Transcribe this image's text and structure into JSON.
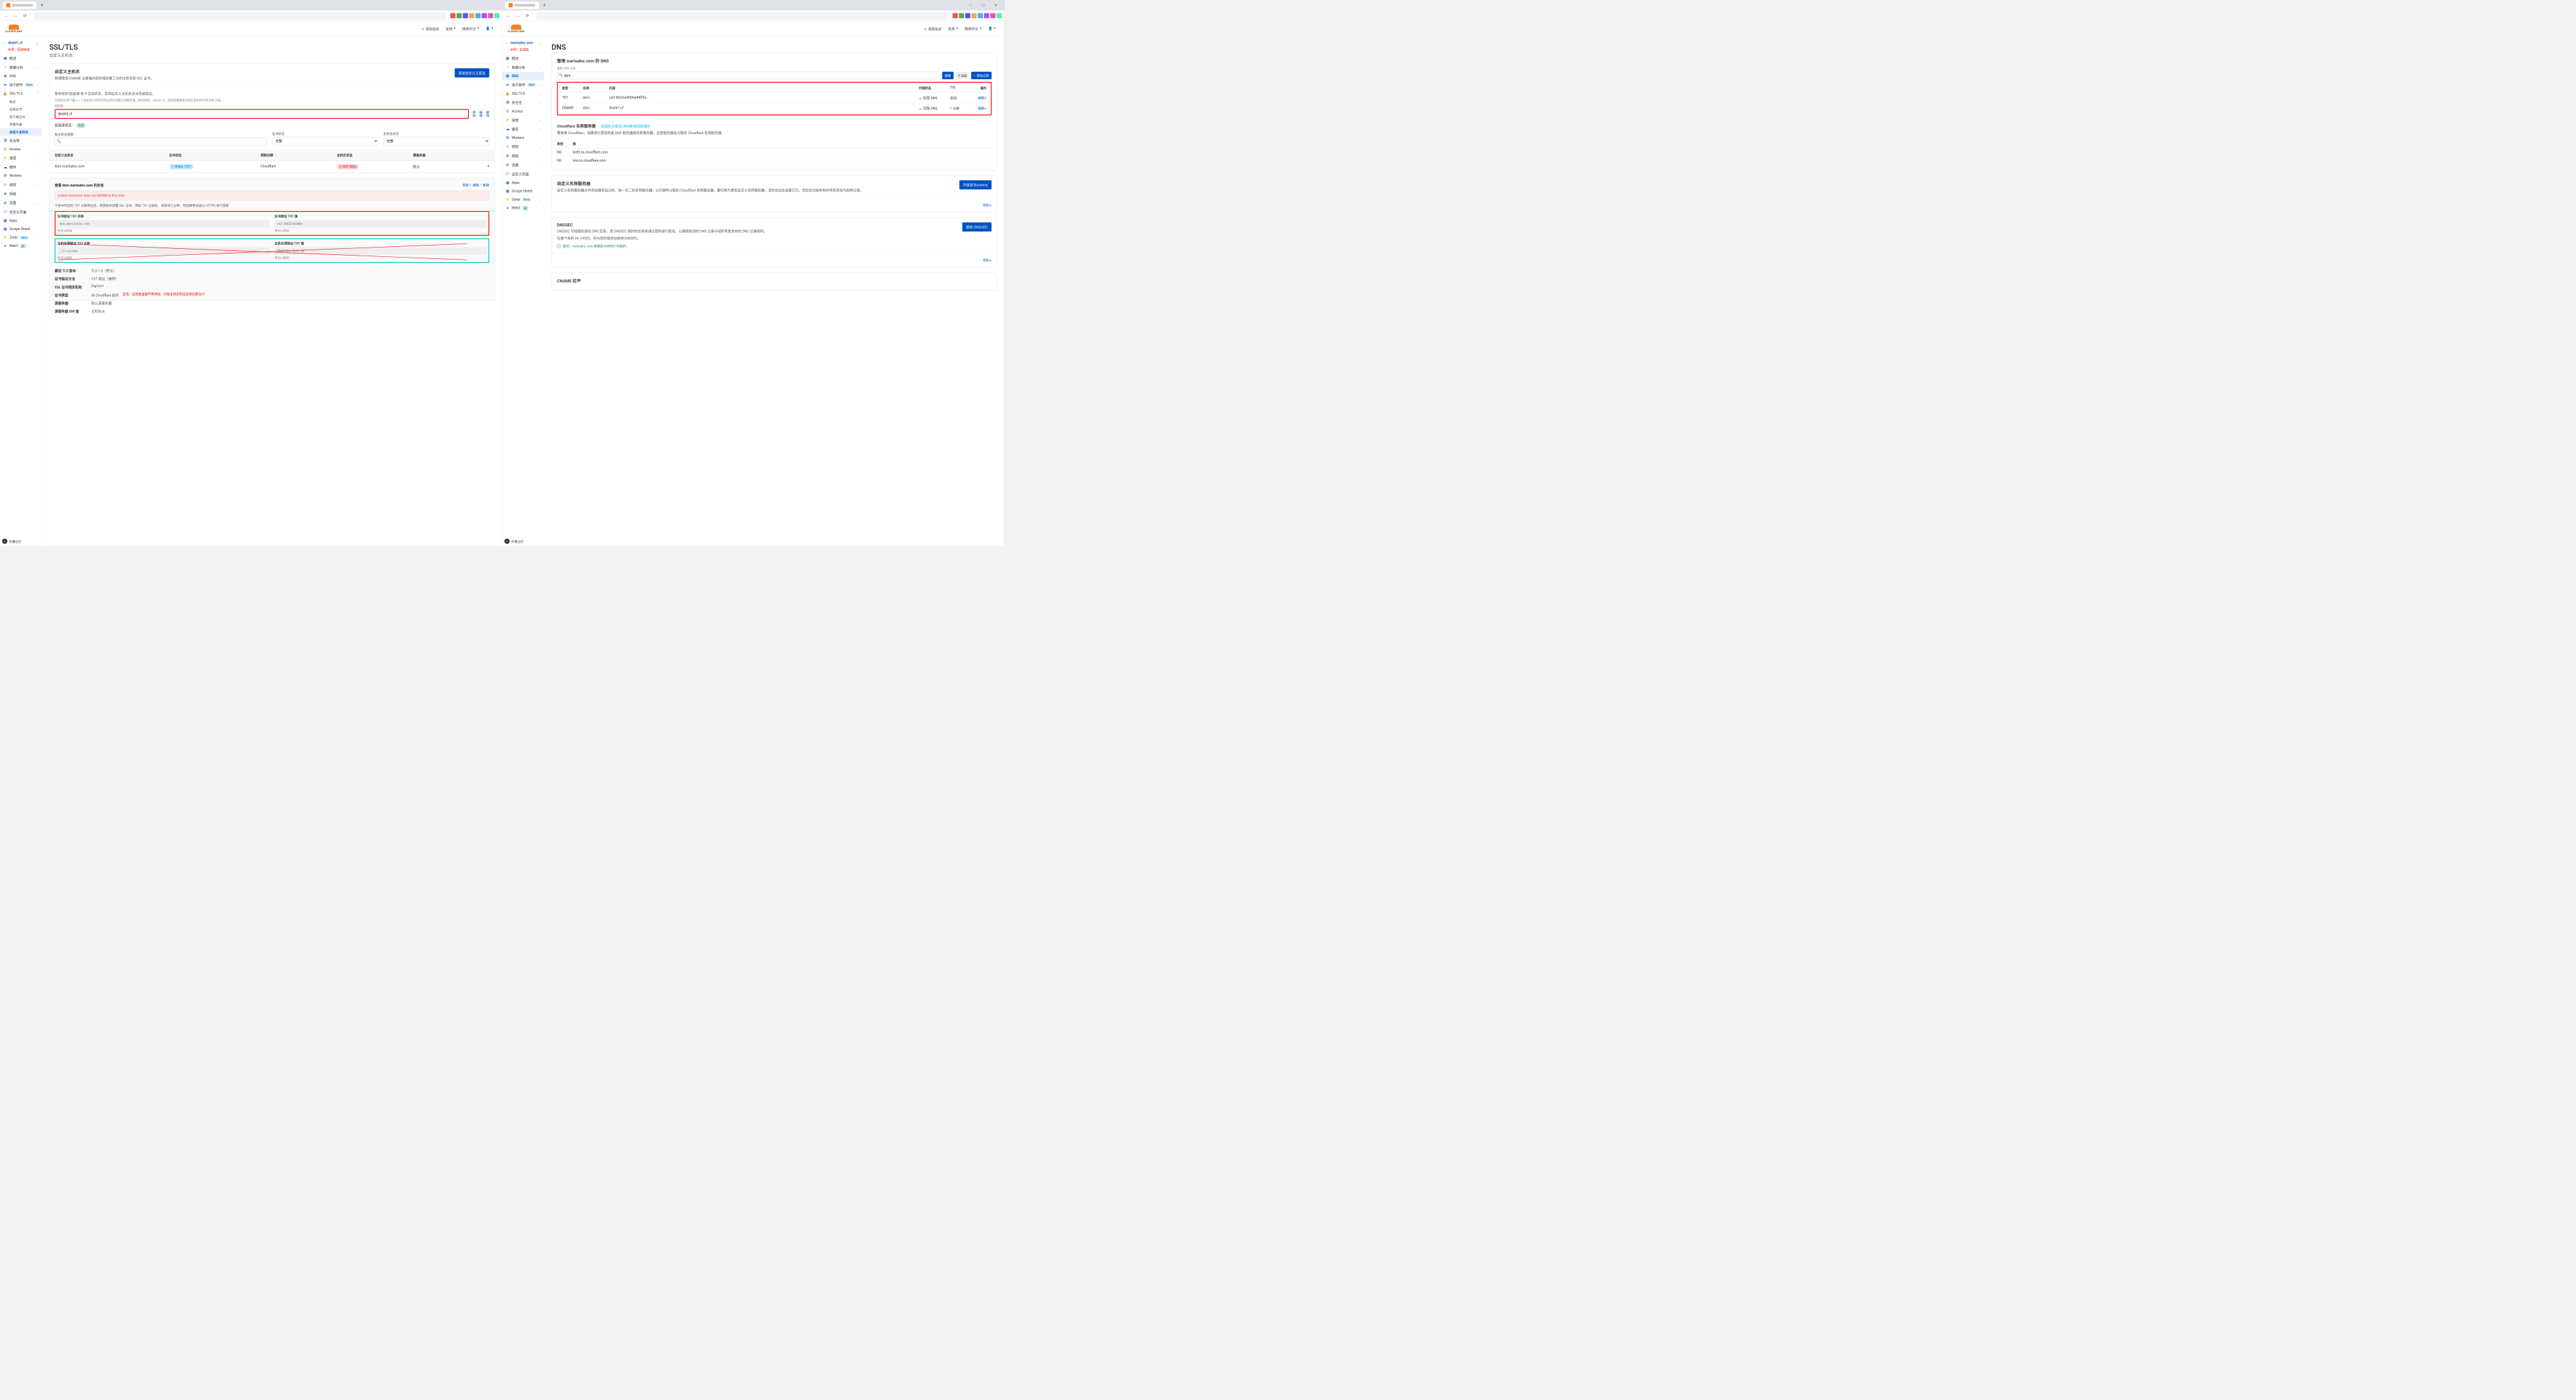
{
  "browser": {
    "newtab": "+",
    "win": {
      "min": "—",
      "max": "☐",
      "close": "✕"
    }
  },
  "header": {
    "add_site": "添加站点",
    "support": "支持",
    "lang": "简体中文",
    "logo": "CLOUDFLARE"
  },
  "left": {
    "crumb": "dnsht1.cf",
    "anno": "示例：回源域名",
    "nav": [
      {
        "ico": "▦",
        "label": "概述"
      },
      {
        "ico": "◔",
        "label": "数据分析",
        "car": "⌄"
      },
      {
        "ico": "⧉",
        "label": "DNS"
      },
      {
        "ico": "✉",
        "label": "电子邮件",
        "badge": "Beta",
        "car": "⌄"
      },
      {
        "ico": "🔒",
        "label": "SSL/TLS",
        "car": "^",
        "children": [
          "概述",
          "边缘证书",
          "客户端证书",
          "源服务器",
          "自定义主机名"
        ]
      },
      {
        "ico": "🛡",
        "label": "安全性",
        "car": "⌄"
      },
      {
        "ico": "⊙",
        "label": "Access"
      },
      {
        "ico": "⚡",
        "label": "速度",
        "car": "⌄"
      },
      {
        "ico": "☁",
        "label": "缓存",
        "car": "⌄"
      },
      {
        "ico": "⚙",
        "label": "Workers"
      },
      {
        "ico": "⟐",
        "label": "规则",
        "car": "⌄"
      },
      {
        "ico": "⊕",
        "label": "网络"
      },
      {
        "ico": "⇄",
        "label": "流量",
        "car": "⌄"
      },
      {
        "ico": "🏳",
        "label": "自定义页面"
      },
      {
        "ico": "▦",
        "label": "Apps"
      },
      {
        "ico": "▦",
        "label": "Scrape Shield"
      },
      {
        "ico": "⚡",
        "label": "Zaraz",
        "badge": "Beta",
        "car": "⌄"
      },
      {
        "ico": "✦",
        "label": "Web3",
        "badge": "新"
      }
    ],
    "page": {
      "h1": "SSL/TLS",
      "sub": "自定义主机名",
      "card1_title": "自定义主机名",
      "card1_desc": "管理使用 CNAME 记录指向您的域的第三方的主机名和 SSL 证书。",
      "add_btn": "添加自定义主机名",
      "note1": "除非您的\"回退源\"处于活动状态，否则自定义主机名无法完成验证。",
      "note2": "在您的区域下输入一个主机名以用作您的主机名的默认源服务器。例如回退，dnsht1.cf。回退源需要是您的区域中的代理 DNS 记录。",
      "fallback_label": "回退源",
      "fallback_value": "dnsht1.cf",
      "refresh": "刷新",
      "edit": "编辑",
      "delete": "删除",
      "status_label": "回退源状态：",
      "status_val": "有效",
      "search_label": "按主机名搜索",
      "cert_status_label": "证书状态",
      "host_status_label": "主机名状态",
      "all": "全部",
      "cols": {
        "hn": "自定义主机名",
        "cs": "证书状态",
        "dd": "到期日期",
        "hs": "主机名状态",
        "os": "源服务器"
      },
      "row": {
        "hn": "dsm.marisalnc.com",
        "cs": "待验证 (TXT)",
        "dd": "Cloudflare",
        "hs": "待定 (错误)",
        "os": "默认"
      },
      "detail_title_pre": "查看 ",
      "detail_title_dom": "dsm.marisalnc.com",
      "detail_title_post": " 的状态",
      "err": "custom hostname does not CNAME to this zone.",
      "detail_note": "下表中列出的 TXT 记录到位后，将颁发并部署 SSL 证书。添加 TXT 记录后，请等待几分钟，然后再尝试通过 HTTPS 进行连接",
      "cert_txt_name_label": "证书验证 TXT 名称",
      "cert_txt_value_label": "证书验证 TXT 值",
      "cert_txt_name": "dsm.marisalnc.com",
      "cert_txt_value": "ca3-3b63ce4306e",
      "host_txt_name_label": "主机名预验证 TXT 名称",
      "host_txt_value_label": "主机名预验证 TXT 值",
      "host_txt_name": "_cf-custom-",
      "host_txt_value": "20d4f16e-1bf1-49",
      "copy": "单击以复制",
      "blue_anno": "蓝色：蓝色框里面不用添加，仅限主域名和自选域名都在CF",
      "props": [
        {
          "k": "最低 TLS 版本",
          "v": "TLS 1.0（默认）"
        },
        {
          "k": "证书验证方法",
          "v": "TXT 验证（推荐）"
        },
        {
          "k": "SSL 证书颁发机构",
          "v": "DigiCert"
        },
        {
          "k": "证书类型",
          "v": "由 Cloudflare 提供"
        },
        {
          "k": "源服务器",
          "v": "默认源服务器"
        },
        {
          "k": "源服务器 SNI 值",
          "v": "主机标头"
        }
      ]
    }
  },
  "right": {
    "crumb": "marisalnc.com",
    "anno": "示例：主域名",
    "nav": [
      {
        "ico": "▦",
        "label": "概述"
      },
      {
        "ico": "◔",
        "label": "数据分析",
        "car": "⌄"
      },
      {
        "ico": "⧉",
        "label": "DNS"
      },
      {
        "ico": "✉",
        "label": "电子邮件",
        "badge": "Beta",
        "car": "⌄"
      },
      {
        "ico": "🔒",
        "label": "SSL/TLS",
        "car": "⌄"
      },
      {
        "ico": "🛡",
        "label": "安全性",
        "car": "⌄"
      },
      {
        "ico": "⊙",
        "label": "Access"
      },
      {
        "ico": "⚡",
        "label": "速度",
        "car": "⌄"
      },
      {
        "ico": "☁",
        "label": "缓存",
        "car": "⌄"
      },
      {
        "ico": "⚙",
        "label": "Workers"
      },
      {
        "ico": "⟐",
        "label": "规则",
        "car": "⌄"
      },
      {
        "ico": "⊕",
        "label": "网络"
      },
      {
        "ico": "⇄",
        "label": "流量",
        "car": "⌄"
      },
      {
        "ico": "🏳",
        "label": "自定义页面"
      },
      {
        "ico": "▦",
        "label": "Apps"
      },
      {
        "ico": "▦",
        "label": "Scrape Shield"
      },
      {
        "ico": "⚡",
        "label": "Zaraz",
        "badge": "Beta",
        "car": "⌄"
      },
      {
        "ico": "✦",
        "label": "Web3",
        "badge": "新"
      }
    ],
    "page": {
      "h1": "DNS",
      "mgmt": "管理 marisalnc.com 的 DNS",
      "search_label": "搜索 DNS 记录",
      "search_value": "dsm",
      "search_btn": "搜索",
      "adv": "高级",
      "add_rec": "+ 添加记录",
      "cols": {
        "type": "类型",
        "name": "名称",
        "content": "内容",
        "proxy": "代理状态",
        "ttl": "TTL",
        "actions": "操作"
      },
      "rows": [
        {
          "type": "TXT",
          "name": "dsm",
          "content": "ca3-3b63ce4306e44f0fa...",
          "proxy": "仅限 DNS",
          "ttl": "自动",
          "act": "编辑 ▸"
        },
        {
          "type": "CNAME",
          "name": "dsm",
          "content": "dnsht1.cf",
          "proxy": "仅限 DNS",
          "ttl": "1 分钟",
          "act": "编辑 ▸"
        }
      ],
      "ns_title": "Cloudflare 名称服务器",
      "ns_anno": "自选的主域名CNAME到回源域名",
      "ns_desc": "要使用 Cloudflare，请确保已更改权威 DNS 服务器或名称服务器。这些服务器是分配的 Cloudflare 名称服务器。",
      "ns_cols": {
        "type": "类型",
        "val": "值"
      },
      "ns": [
        {
          "type": "NS",
          "val": "brett.ns.cloudflare.com"
        },
        {
          "type": "NS",
          "val": "lola.ns.cloudflare.com"
        }
      ],
      "cns_title": "自定义名称服务器",
      "cns_desc": "自定义名称服务器允许您创建您自己的、独一无二的名称服务器，以代替所分配的 Cloudflare 名称服务器。要切换为使用自定义名称服务器，请先在此处创建它们，然后在注册机构中将其添加为粘附记录。",
      "cns_btn": "升级到 Business",
      "help": "帮助 ▸",
      "dnssec_title": "DNSSEC",
      "dnssec_desc": "DNSSEC 可抵御伪造的 DNS 应答。受 DNSSEC 保护的区域将通过密码进行签名，以确保收到的 DNS 记录与域所有者发布的 DNS 记录相同。",
      "dnssec_desc2": "在接下来的 24 小时内，将为您的域自动启用 DNSSEC。",
      "dnssec_btn": "禁用 DNSSEC",
      "dnssec_ok": "成功！marisalnc.com 将受到 DNSSEC 的保护。",
      "cname_title": "CNAME 拉平"
    }
  },
  "collapse": "折叠边栏"
}
